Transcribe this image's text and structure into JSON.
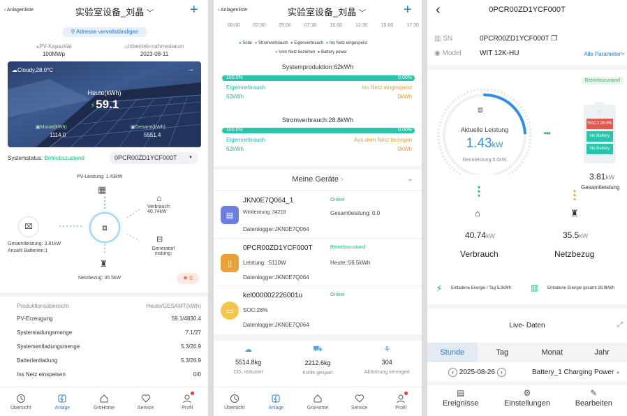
{
  "p1": {
    "back": "Anlagenliste",
    "title": "实验室设备_刘晶",
    "address_btn": "Adresse vervollständigen",
    "capacity_label": "PV-Kapazität",
    "capacity_value": "100MWp",
    "commission_label": "Inbetrieb-nahmedatum",
    "commission_value": "2023-08-11",
    "weather": "Cloudy,28.0°C",
    "today_label": "Heute(kWh)",
    "today_value": "59.1",
    "month_label": "Monat(kWh)",
    "month_value": "1114.0",
    "total_label": "Gesamt(kWh)",
    "total_value": "5551.4",
    "status_label": "Systemstatus:",
    "status_value": "Betriebszustand",
    "device_select": "0PCR00ZD1YCF000T",
    "pv_power": "PV-Leistung: 1.43kW",
    "consumption": "Verbrauch: 40.74kW",
    "generator": "Generatorl eistung:",
    "battery_total": "Gesamtleistung: 3.81kW",
    "battery_count": "Anzahl Batterien:1",
    "grid": "Netzbezug: 35.5kW",
    "alarm_count": "0",
    "overview_label": "Produktionsübersicht",
    "overview_unit": "Heute/GESAMT(kWh)",
    "rows": [
      {
        "k": "PV-Erzeugung",
        "v": "59.1/4830.4"
      },
      {
        "k": "Systemladungsmenge",
        "v": "7.1/27"
      },
      {
        "k": "Systementladungsmenge",
        "v": "5.3/26.9"
      },
      {
        "k": "Batterientladung",
        "v": "5.3/26.9"
      },
      {
        "k": "Ins Netz einspeisen",
        "v": "0/0"
      }
    ]
  },
  "p2": {
    "back": "Anlagenliste",
    "title": "实验室设备_刘晶",
    "times": [
      "00:00",
      "02:30",
      "05:00",
      "07:30",
      "10:00",
      "12:30",
      "15:00",
      "17:30"
    ],
    "legend": [
      "Solar",
      "Stromverbrauch",
      "Eigenverbrauch",
      "Ins Netz eingespeist",
      "Vom Netz beziehen",
      "Battery power"
    ],
    "legend_colors": [
      "#3cb371",
      "#e8734a",
      "#3d6fd8",
      "#4aa3df",
      "#f0932b",
      "#c0392b"
    ],
    "prod_title": "Systemproduktion:62kWh",
    "prod_left_pct": "100.0%",
    "prod_right_pct": "0.00%",
    "prod_left_label": "Eigenverbrauch",
    "prod_right_label": "Ins Netz eingespeist",
    "prod_left_val": "62kWh",
    "prod_right_val": "0kWh",
    "cons_title": "Stromverbrauch:28.8kWh",
    "cons_left_pct": "100.0%",
    "cons_right_pct": "0.00%",
    "cons_left_label": "Eigenverbrauch",
    "cons_right_label": "Aus dem Netz bezogen",
    "cons_left_val": "62kWh",
    "cons_right_val": "0kWh",
    "devices_title": "Meine Geräte",
    "devices": [
      {
        "name": "JKN0E7Q064_1",
        "status": "Online",
        "l1": "Wirkleistung: 34218",
        "r1": "Gesamtleistung: 0.0",
        "l2": "Datenlogger:JKN0E7Q064"
      },
      {
        "name": "0PCR00ZD1YCF000T",
        "status": "Betriebszustand",
        "l1": "Leistung: :5110W",
        "r1": "Heute::56.5kWh",
        "l2": "Datenlogger:JKN0E7Q064"
      },
      {
        "name": "kel000002226001u",
        "status": "Online",
        "l1": "SOC:28%",
        "r1": "",
        "l2": "Datenlogger:JKN0E7Q064"
      }
    ],
    "eco": [
      {
        "v": "5514.8kg",
        "l": "CO₂ reduziert"
      },
      {
        "v": "2212.6kg",
        "l": "Kohle gespart"
      },
      {
        "v": "304",
        "l": "Abholzung verringert"
      }
    ]
  },
  "p3": {
    "title": "0PCR00ZD1YCF000T",
    "sn_label": "SN",
    "sn_value": "0PCR00ZD1YCF000T",
    "model_label": "Model",
    "model_value": "WIT 12K-HU",
    "all_params": "Alle Parameter>",
    "status_badge": "Betriebszustand",
    "current_label": "Aktuelle Leistung",
    "current_value": "1.43",
    "current_unit": "kW",
    "rated": "Nennleistung:6.0kW",
    "gauge_fraction": 0.24,
    "soc": "SOC1:28.0%",
    "no_battery_1": "No Battery",
    "no_battery_2": "No Battery",
    "battery_value": "3.81",
    "battery_unit": "kW",
    "battery_label": "Gesamtleistung",
    "cons_value": "40.74",
    "cons_unit": "kW",
    "cons_label": "Verbrauch",
    "grid_value": "35.5",
    "grid_unit": "kW",
    "grid_label": "Netzbezug",
    "discharge_today": "Entladene Energie / Tag 5.3kWh",
    "discharge_total": "Entladene Energie gesamt 26.9kWh",
    "live_title": "Live- Daten",
    "tabs": [
      "Stunde",
      "Tag",
      "Monat",
      "Jahr"
    ],
    "date": "2025-08-26",
    "series_select": "Battery_1 Charging Power",
    "actions": [
      "Ereignisse",
      "Einstellungen",
      "Bearbeiten"
    ]
  },
  "nav": [
    "Übersicht",
    "Anlage",
    "GroHome",
    "Service",
    "Profil"
  ],
  "colors": {
    "accent": "#1f7bd6",
    "teal": "#2ac3ac",
    "green": "#20b880",
    "orange": "#e8a23a"
  }
}
